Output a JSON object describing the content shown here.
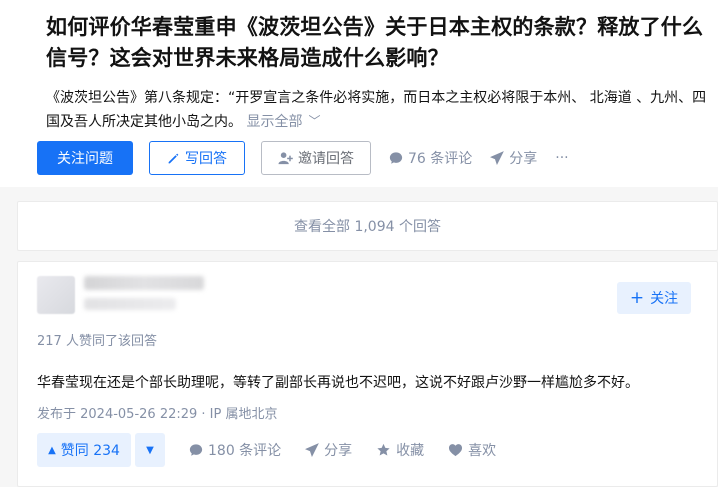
{
  "question": {
    "title": "如何评价华春莹重申《波茨坦公告》关于日本主权的条款？释放了什么信号？这会对世界未来格局造成什么影响？",
    "excerpt": "《波茨坦公告》第八条规定：“开罗宣言之条件必将实施，而日本之主权必将限于本州、 北海道 、九州、四国及吾人所决定其他小岛之内。",
    "show_all": "显示全部"
  },
  "actions": {
    "follow_question": "关注问题",
    "write_answer": "写回答",
    "invite_answer": "邀请回答",
    "comments": "76 条评论",
    "share": "分享",
    "more": "···"
  },
  "view_all_answers": "查看全部 1,094 个回答",
  "answer": {
    "follow_label": "关注",
    "vote_summary": "217 人赞同了该回答",
    "content": "华春莹现在还是个部长助理呢，等转了副部长再说也不迟吧，这说不好跟卢沙野一样尴尬多不好。",
    "publish_time": "发布于 2024-05-26 22:29 · IP 属地北京",
    "upvote": "赞同 234",
    "comments": "180 条评论",
    "share": "分享",
    "collect": "收藏",
    "like": "喜欢"
  },
  "colors": {
    "brand_blue": "#1772f6",
    "meta_gray": "#8590a6",
    "vote_bg": "#e8f1fe"
  }
}
